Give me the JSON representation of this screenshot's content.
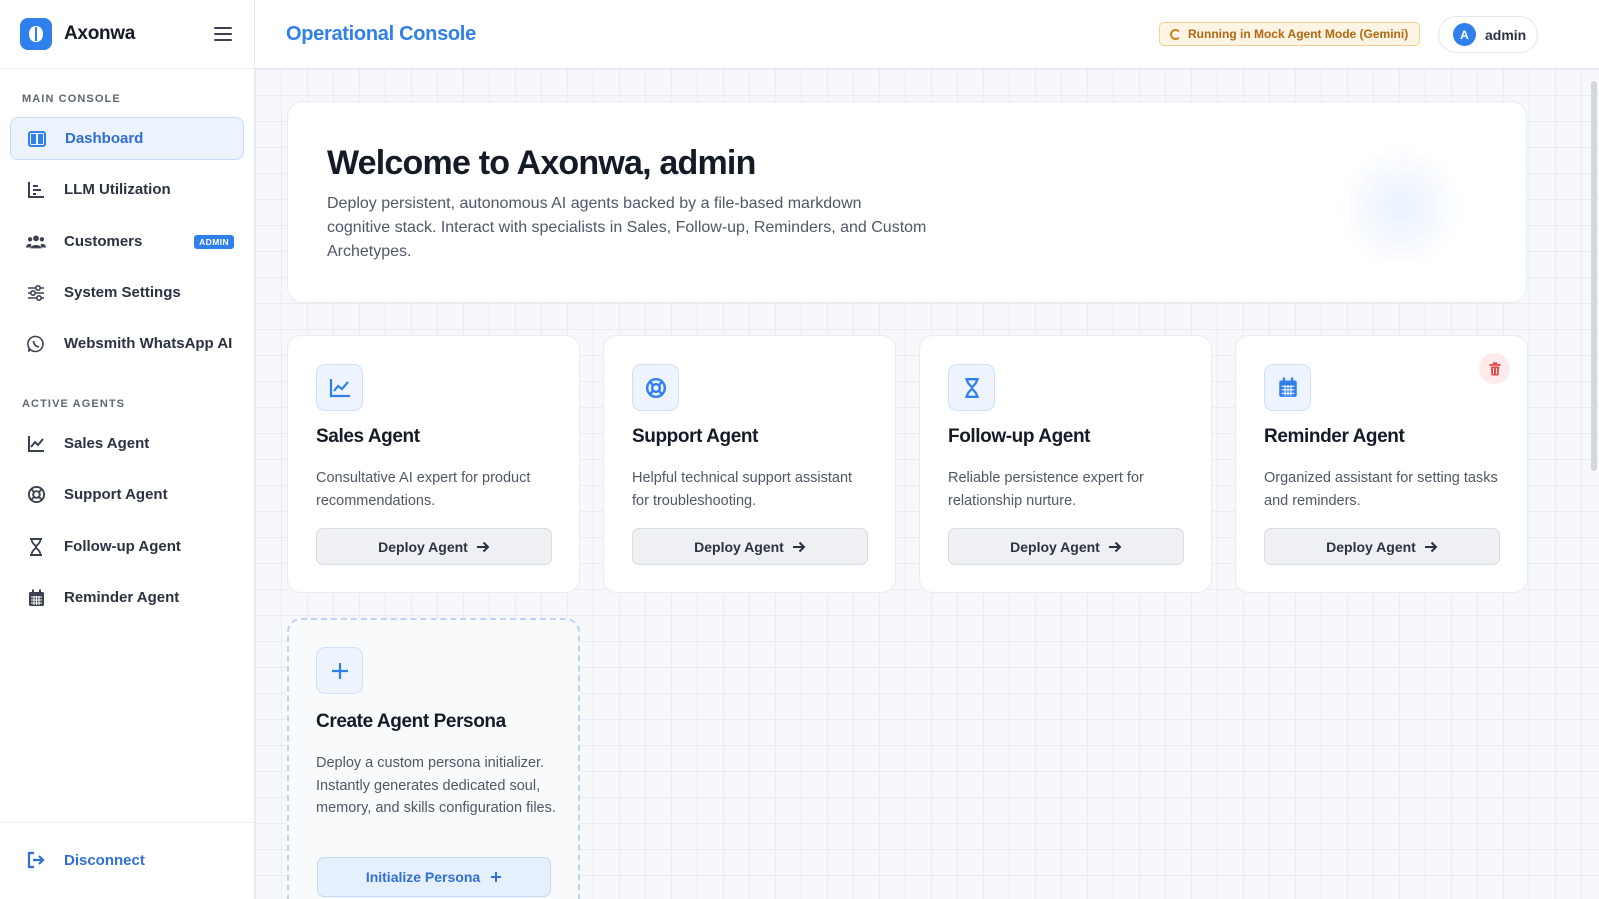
{
  "brand": {
    "name": "Axonwa"
  },
  "sidebar": {
    "main_label": "MAIN CONSOLE",
    "main_items": [
      {
        "label": "Dashboard",
        "icon": "layout-icon"
      },
      {
        "label": "LLM Utilization",
        "icon": "bar-chart-icon"
      },
      {
        "label": "Customers",
        "icon": "users-icon",
        "badge": "ADMIN"
      },
      {
        "label": "System Settings",
        "icon": "sliders-icon"
      },
      {
        "label": "Websmith WhatsApp AI",
        "icon": "whatsapp-icon"
      }
    ],
    "agents_label": "ACTIVE AGENTS",
    "agent_items": [
      {
        "label": "Sales Agent",
        "icon": "line-chart-icon"
      },
      {
        "label": "Support Agent",
        "icon": "lifebuoy-icon"
      },
      {
        "label": "Follow-up Agent",
        "icon": "hourglass-icon"
      },
      {
        "label": "Reminder Agent",
        "icon": "calendar-icon"
      }
    ],
    "disconnect_label": "Disconnect"
  },
  "header": {
    "title": "Operational Console",
    "mode_status": "Running in Mock Agent Mode (Gemini)",
    "user": {
      "initial": "A",
      "name": "admin"
    }
  },
  "hero": {
    "title": "Welcome to Axonwa, admin",
    "description": "Deploy persistent, autonomous AI agents backed by a file-based markdown cognitive stack. Interact with specialists in Sales, Follow-up, Reminders, and Custom Archetypes."
  },
  "cards": [
    {
      "title": "Sales Agent",
      "description": "Consultative AI expert for product recommendations.",
      "button": "Deploy Agent",
      "icon": "line-chart-icon"
    },
    {
      "title": "Support Agent",
      "description": "Helpful technical support assistant for troubleshooting.",
      "button": "Deploy Agent",
      "icon": "lifebuoy-icon"
    },
    {
      "title": "Follow-up Agent",
      "description": "Reliable persistence expert for relationship nurture.",
      "button": "Deploy Agent",
      "icon": "hourglass-icon"
    },
    {
      "title": "Reminder Agent",
      "description": "Organized assistant for setting tasks and reminders.",
      "button": "Deploy Agent",
      "icon": "calendar-icon"
    }
  ],
  "create_card": {
    "title": "Create Agent Persona",
    "description": "Deploy a custom persona initializer. Instantly generates dedicated soul, memory, and skills configuration files.",
    "button": "Initialize Persona"
  },
  "colors": {
    "accent": "#2f80ed",
    "warning": "#b4670e",
    "danger": "#e5484d"
  }
}
